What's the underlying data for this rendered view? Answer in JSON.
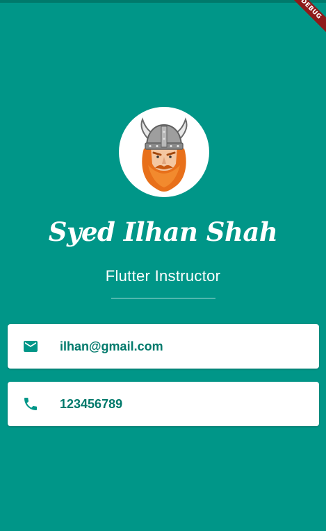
{
  "app": {
    "debug_banner": "DEBUG"
  },
  "profile": {
    "name": "Syed Ilhan Shah",
    "title": "Flutter Instructor",
    "avatar_icon": "viking-avatar"
  },
  "contacts": [
    {
      "icon": "mail-icon",
      "value": "ilhan@gmail.com"
    },
    {
      "icon": "phone-icon",
      "value": "123456789"
    }
  ],
  "colors": {
    "background": "#009688",
    "card": "#ffffff",
    "accent_text": "#00796b",
    "debug_ribbon": "#8e1a1a"
  }
}
